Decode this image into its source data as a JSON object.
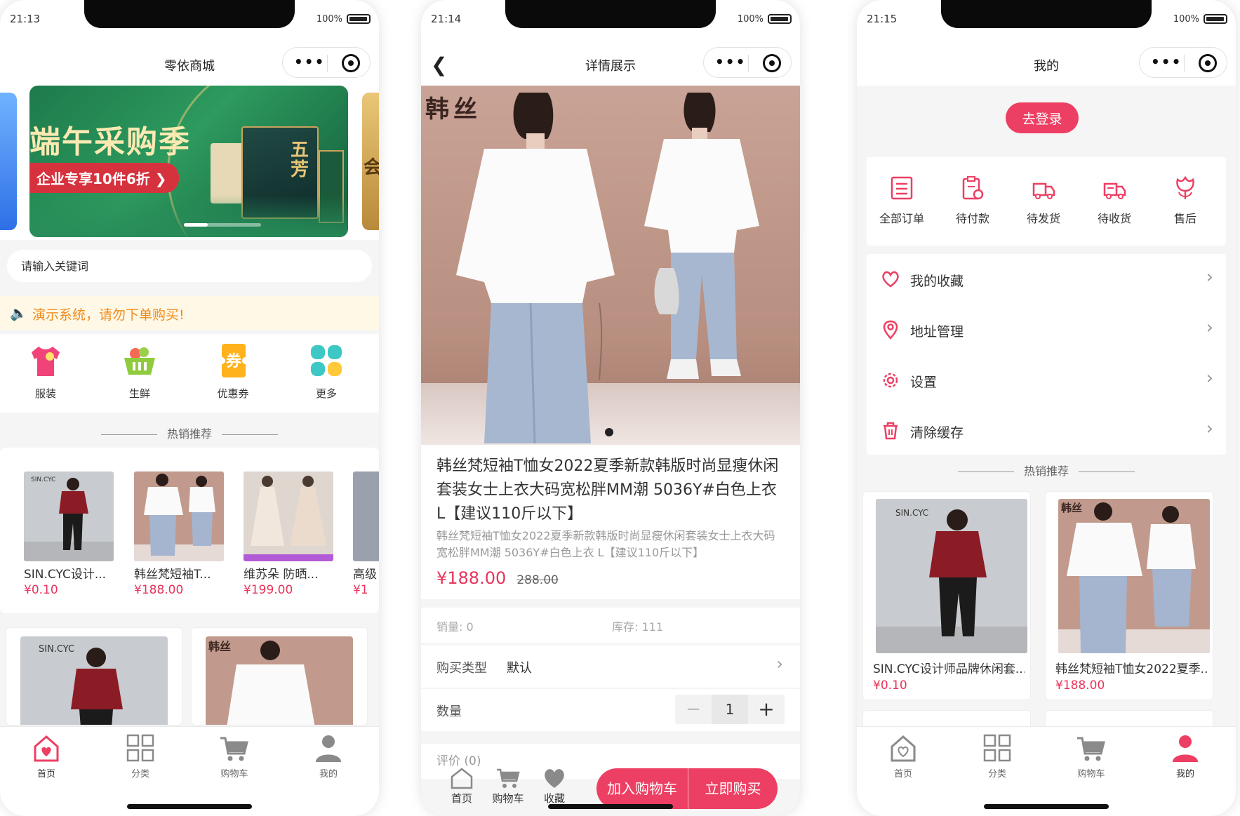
{
  "phones": [
    {
      "status": {
        "time": "21:13",
        "battery": "100%"
      },
      "nav": {
        "title": "零依商城"
      },
      "banner": {
        "title": "端午采购季",
        "subtitle": "企业专享10件6折 ❯",
        "box_text": "五芳",
        "side_right_text": "会"
      },
      "search": {
        "placeholder": "请输入关键词"
      },
      "notice": {
        "text": "演示系统，请勿下单购买!"
      },
      "categories": [
        {
          "label": "服装",
          "icon": "tshirt-icon"
        },
        {
          "label": "生鲜",
          "icon": "basket-icon"
        },
        {
          "label": "优惠券",
          "icon": "coupon-icon"
        },
        {
          "label": "更多",
          "icon": "grid-icon"
        }
      ],
      "section_title": "热销推荐",
      "hot_items": [
        {
          "name": "SIN.CYC设计...",
          "price": "¥0.10"
        },
        {
          "name": "韩丝梵短袖T...",
          "price": "¥188.00"
        },
        {
          "name": "维苏朵 防晒...",
          "price": "¥199.00"
        },
        {
          "name": "高级",
          "price": "¥1"
        }
      ],
      "tabbar": [
        {
          "label": "首页",
          "icon": "home-icon",
          "active": true
        },
        {
          "label": "分类",
          "icon": "category-icon",
          "active": false
        },
        {
          "label": "购物车",
          "icon": "cart-icon",
          "active": false
        },
        {
          "label": "我的",
          "icon": "user-icon",
          "active": false
        }
      ]
    },
    {
      "status": {
        "time": "21:14",
        "battery": "100%"
      },
      "nav": {
        "title": "详情展示"
      },
      "image_brand": "韩丝",
      "product": {
        "title": "韩丝梵短袖T恤女2022夏季新款韩版时尚显瘦休闲套装女士上衣大码宽松胖MM潮 5036Y#白色上衣 L【建议110斤以下】",
        "subtitle": "韩丝梵短袖T恤女2022夏季新款韩版时尚显瘦休闲套装女士上衣大码宽松胖MM潮 5036Y#白色上衣 L【建议110斤以下】",
        "price": "¥188.00",
        "original_price": "288.00"
      },
      "stats": {
        "sales": "销量: 0",
        "stock": "库存: 111"
      },
      "buy_type": {
        "label": "购买类型",
        "value": "默认"
      },
      "quantity": {
        "label": "数量",
        "value": "1",
        "minus": "−",
        "plus": "+"
      },
      "review": {
        "label": "评价 (0)"
      },
      "bottom": {
        "home": "首页",
        "cart": "购物车",
        "favorite": "收藏",
        "add_to_cart": "加入购物车",
        "buy_now": "立即购买"
      }
    },
    {
      "status": {
        "time": "21:15",
        "battery": "100%"
      },
      "nav": {
        "title": "我的"
      },
      "login": "去登录",
      "orders": [
        {
          "label": "全部订单",
          "icon": "order-list-icon"
        },
        {
          "label": "待付款",
          "icon": "pay-icon"
        },
        {
          "label": "待发货",
          "icon": "truck-icon"
        },
        {
          "label": "待收货",
          "icon": "delivery-icon"
        },
        {
          "label": "售后",
          "icon": "flower-icon"
        }
      ],
      "menu": [
        {
          "label": "我的收藏",
          "icon": "heart-icon"
        },
        {
          "label": "地址管理",
          "icon": "location-icon"
        },
        {
          "label": "设置",
          "icon": "gear-icon"
        },
        {
          "label": "清除缓存",
          "icon": "trash-icon"
        }
      ],
      "section_title": "热销推荐",
      "hot_items": [
        {
          "name": "SIN.CYC设计师品牌休闲套...",
          "price": "¥0.10"
        },
        {
          "name": "韩丝梵短袖T恤女2022夏季...",
          "price": "¥188.00"
        }
      ],
      "tabbar": [
        {
          "label": "首页",
          "icon": "home-icon",
          "active": false
        },
        {
          "label": "分类",
          "icon": "category-icon",
          "active": false
        },
        {
          "label": "购物车",
          "icon": "cart-icon",
          "active": false
        },
        {
          "label": "我的",
          "icon": "user-icon",
          "active": true
        }
      ]
    }
  ],
  "colors": {
    "accent": "#ed3f63",
    "price": "#e8345b",
    "notice": "#f08c1d"
  }
}
